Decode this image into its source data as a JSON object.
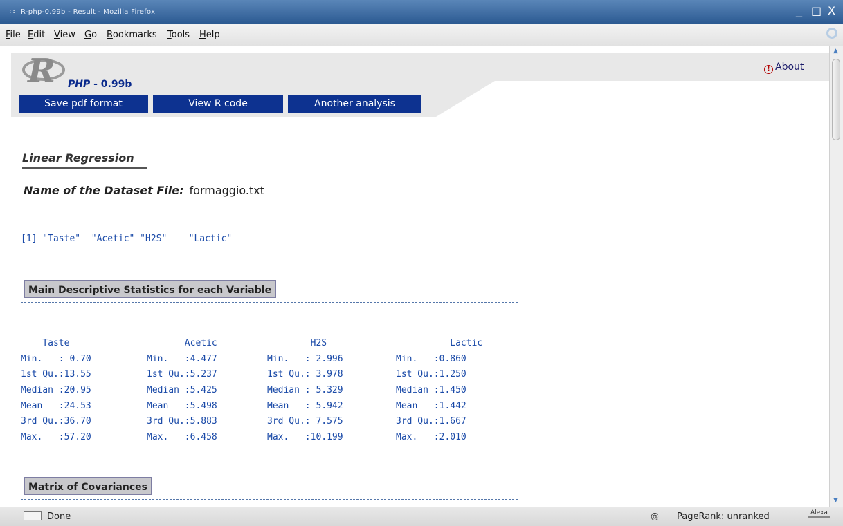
{
  "window": {
    "title": "R-php-0.99b - Result - Mozilla Firefox",
    "grip_icon": "grip-icon",
    "controls": {
      "minimize": "_",
      "maximize": "□",
      "close": "X"
    }
  },
  "menu": {
    "items": [
      "File",
      "Edit",
      "View",
      "Go",
      "Bookmarks",
      "Tools",
      "Help"
    ]
  },
  "header": {
    "logo_letter": "R",
    "brand": "PHP",
    "version": " - 0.99b",
    "buttons": [
      "Save pdf format",
      "View R code",
      "Another analysis"
    ],
    "about_label": "About",
    "about_icon_glyph": "!"
  },
  "main": {
    "heading": "Linear Regression",
    "dataset_label": "Name of the Dataset File:",
    "dataset_value": "formaggio.txt",
    "variables_line": "[1] \"Taste\"  \"Acetic\" \"H2S\"    \"Lactic\"",
    "section1_title": "Main Descriptive Statistics for each Variable",
    "stats_header": [
      "    Taste",
      "       Acetic",
      "        H2S",
      "          Lactic"
    ],
    "stats_rows": [
      [
        "Min.   : 0.70",
        "Min.   :4.477",
        "Min.   : 2.996",
        "Min.   :0.860"
      ],
      [
        "1st Qu.:13.55",
        "1st Qu.:5.237",
        "1st Qu.: 3.978",
        "1st Qu.:1.250"
      ],
      [
        "Median :20.95",
        "Median :5.425",
        "Median : 5.329",
        "Median :1.450"
      ],
      [
        "Mean   :24.53",
        "Mean   :5.498",
        "Mean   : 5.942",
        "Mean   :1.442"
      ],
      [
        "3rd Qu.:36.70",
        "3rd Qu.:5.883",
        "3rd Qu.: 7.575",
        "3rd Qu.:1.667"
      ],
      [
        "Max.   :57.20",
        "Max.   :6.458",
        "Max.   :10.199",
        "Max.   :2.010"
      ]
    ],
    "section2_title": "Matrix of Covariances"
  },
  "status": {
    "text": "Done",
    "pagerank": "PageRank: unranked",
    "alexa": "Alexa",
    "at_glyph": "@"
  }
}
